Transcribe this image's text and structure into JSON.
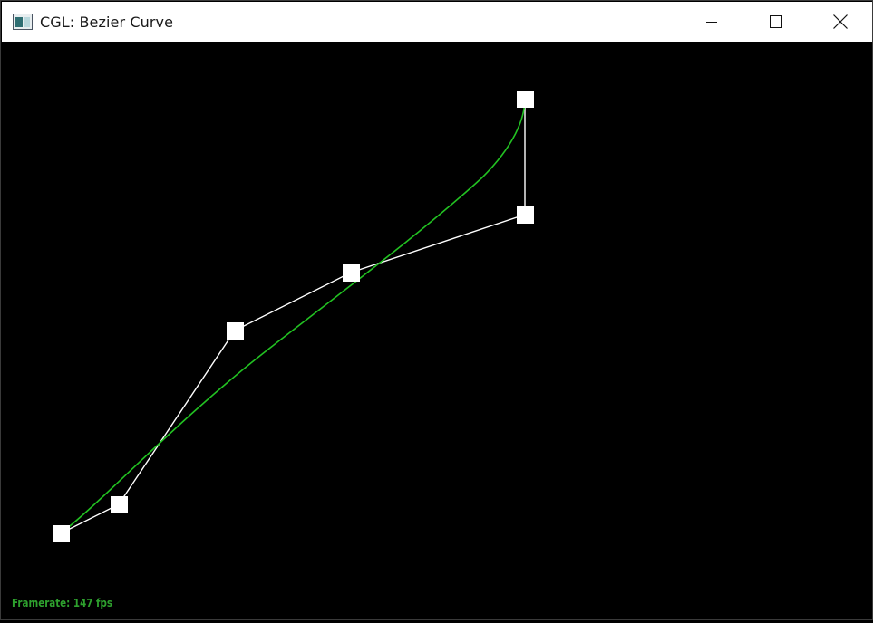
{
  "window": {
    "title": "CGL: Bezier Curve",
    "icons": {
      "app": "app-window-icon",
      "minimize": "minimize-icon",
      "maximize": "maximize-icon",
      "close": "close-icon"
    }
  },
  "viewport": {
    "background": "#000000",
    "curve_color": "#22c122",
    "polygon_color": "#ffffff",
    "point_color": "#ffffff"
  },
  "status": {
    "framerate_text": "Framerate: 147 fps"
  }
}
